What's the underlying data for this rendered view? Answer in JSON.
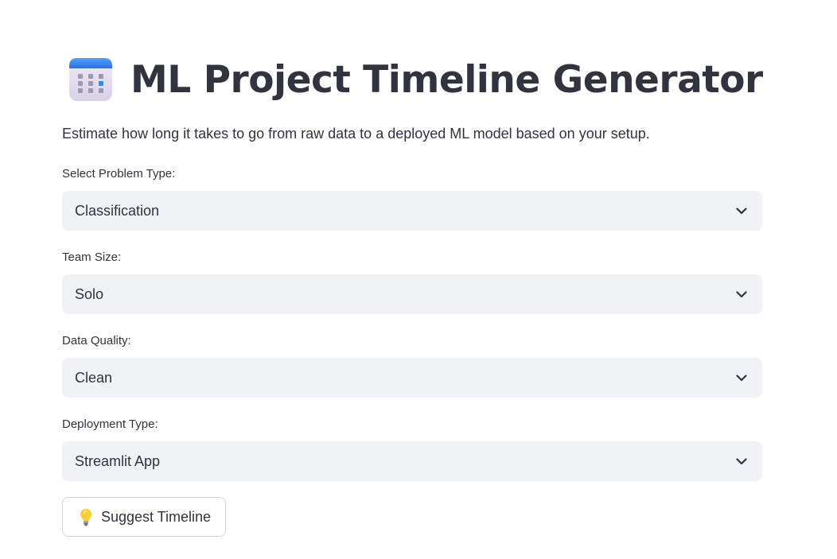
{
  "header": {
    "icon": "calendar-icon",
    "title": "ML Project Timeline Generator",
    "subtitle": "Estimate how long it takes to go from raw data to a deployed ML model based on your setup."
  },
  "form": {
    "problem_type": {
      "label": "Select Problem Type:",
      "value": "Classification"
    },
    "team_size": {
      "label": "Team Size:",
      "value": "Solo"
    },
    "data_quality": {
      "label": "Data Quality:",
      "value": "Clean"
    },
    "deployment_type": {
      "label": "Deployment Type:",
      "value": "Streamlit App"
    }
  },
  "actions": {
    "suggest_icon": "lightbulb-icon",
    "suggest_label": "Suggest Timeline"
  },
  "colors": {
    "text": "#31333f",
    "select_bg": "#f0f2f6",
    "button_border": "#d5d6d9",
    "calendar_header": "#3d8ef0"
  }
}
